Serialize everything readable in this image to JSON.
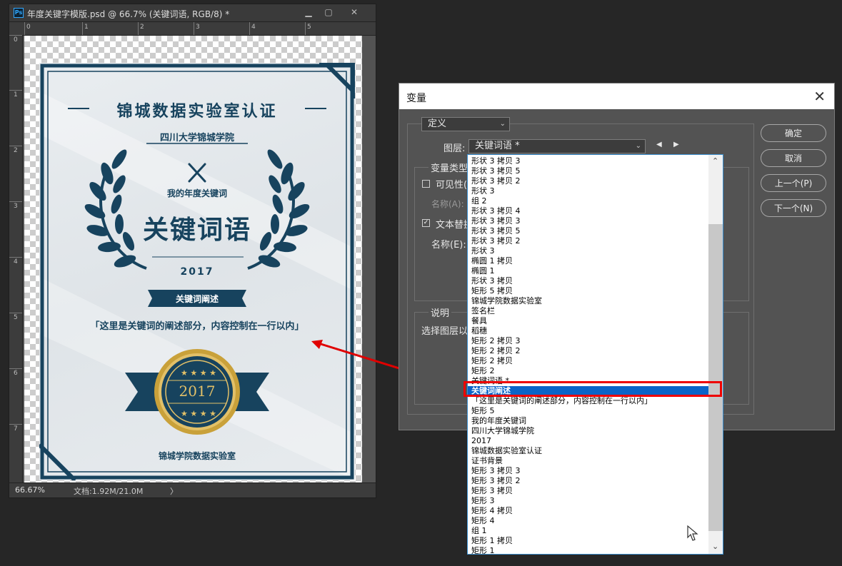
{
  "document": {
    "title": "年度关键字模版.psd @ 66.7% (关键词语, RGB/8) *",
    "ps_icon": "Ps",
    "controls": {
      "minimize": "▁",
      "restore": "▢",
      "close": "✕"
    },
    "ruler_top": [
      "0",
      "1",
      "2",
      "3",
      "4",
      "5"
    ],
    "ruler_left": [
      "0",
      "1",
      "2",
      "3",
      "4",
      "5",
      "6",
      "7"
    ],
    "zoom": "66.67%",
    "doc_info": "文档:1.92M/21.0M",
    "status_arrow": "〉"
  },
  "certificate": {
    "heading": "锦城数据实验室认证",
    "school": "四川大学锦城学院",
    "subtitle": "我的年度关键词",
    "keyword": "关键词语",
    "year": "2017",
    "ribbon": "关键词阐述",
    "description": "「这里是关键词的阐述部分，内容控制在一行以内」",
    "medal_year": "2017",
    "footer": "锦城学院数据实验室"
  },
  "dialog": {
    "title": "变量",
    "close": "✕",
    "definition_select": "定义",
    "layer_label": "图层:",
    "layer_value": "关键词语 *",
    "var_type_label": "变量类型",
    "visibility_label": "可见性(",
    "name_a_label": "名称(A):",
    "text_replace_label": "文本替换",
    "name_e_label": "名称(E):",
    "description_label": "说明",
    "description_text": "选择图层以",
    "buttons": {
      "ok": "确定",
      "cancel": "取消",
      "prev": "上一个(P)",
      "next": "下一个(N)"
    }
  },
  "layer_list": {
    "items": [
      "形状 3 拷贝 3",
      "形状 3 拷贝 5",
      "形状 3 拷贝 2",
      "形状 3",
      "组 2",
      "形状 3 拷贝 4",
      "形状 3 拷贝 3",
      "形状 3 拷贝 5",
      "形状 3 拷贝 2",
      "形状 3",
      "椭圆 1 拷贝",
      "椭圆 1",
      "形状 3 拷贝",
      "矩形 5 拷贝",
      "锦城学院数据实验室",
      "签名栏",
      "餐具",
      "稻穗",
      "矩形 2 拷贝 3",
      "矩形 2 拷贝 2",
      "矩形 2 拷贝",
      "矩形 2",
      "关键词语 *",
      "关键词阐述",
      "「这里是关键词的阐述部分，内容控制在一行以内」",
      "矩形 5",
      "我的年度关键词",
      "四川大学锦城学院",
      "2017",
      "锦城数据实验室认证",
      "证书背景",
      "矩形 3 拷贝 3",
      "矩形 3 拷贝 2",
      "矩形 3 拷贝",
      "矩形 3",
      "矩形 4 拷贝",
      "矩形 4",
      "组 1",
      "矩形 1 拷贝",
      "矩形 1"
    ],
    "selected_index": 23,
    "scroll_up": "⌃",
    "scroll_down": "⌄"
  },
  "colors": {
    "navy": "#17435e",
    "gold": "#c9a13a",
    "selection": "#0a64c8",
    "annotation_red": "#e00000"
  }
}
